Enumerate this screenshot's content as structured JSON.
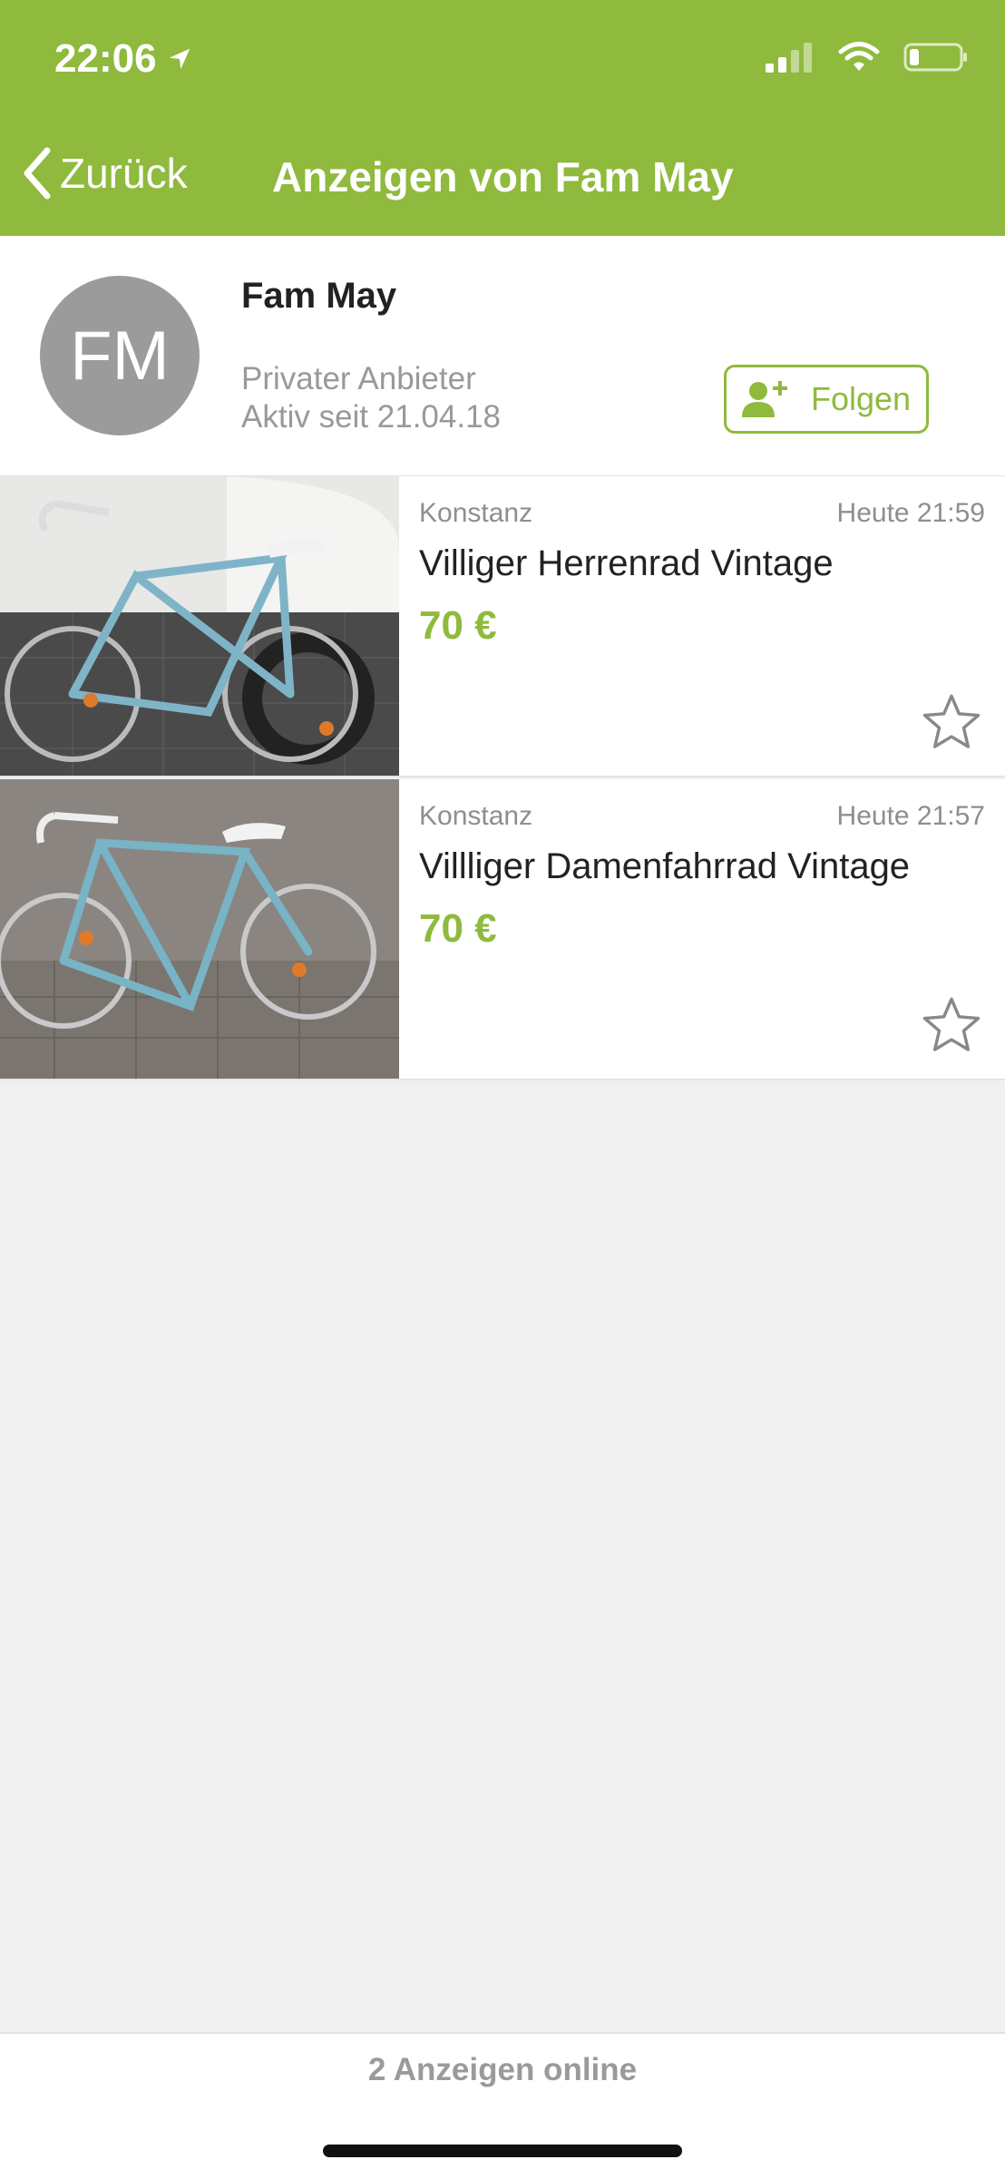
{
  "status": {
    "time": "22:06"
  },
  "nav": {
    "back_label": "Zurück",
    "title": "Anzeigen von Fam May"
  },
  "profile": {
    "initials": "FM",
    "name": "Fam May",
    "type": "Privater Anbieter",
    "since": "Aktiv seit 21.04.18",
    "follow_label": "Folgen"
  },
  "listings": [
    {
      "location": "Konstanz",
      "time": "Heute 21:59",
      "title": "Villiger Herrenrad Vintage",
      "price": "70 €"
    },
    {
      "location": "Konstanz",
      "time": "Heute 21:57",
      "title": "Villliger Damenfahrrad Vintage",
      "price": "70 €"
    }
  ],
  "footer": {
    "count": "2 Anzeigen online"
  },
  "colors": {
    "brand": "#8fba3d",
    "avatar": "#9b9b9b"
  }
}
